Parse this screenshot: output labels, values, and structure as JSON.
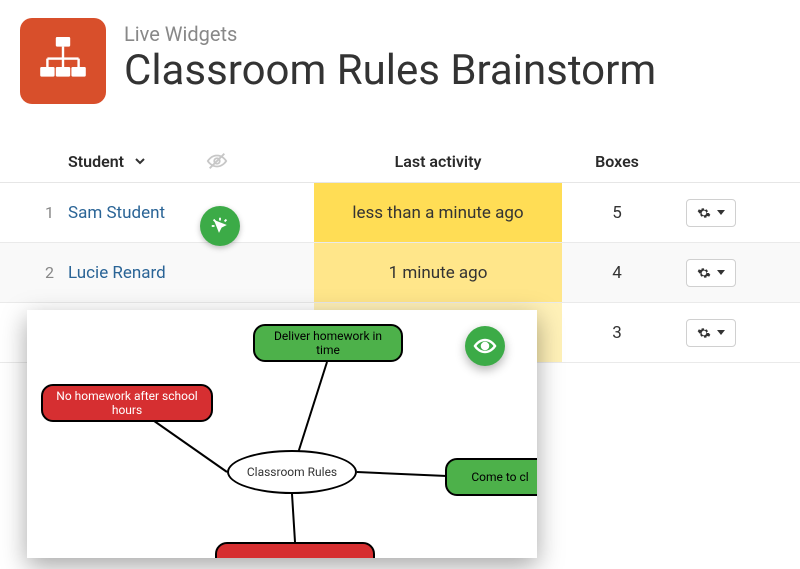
{
  "header": {
    "subtitle": "Live Widgets",
    "title": "Classroom Rules Brainstorm"
  },
  "table": {
    "columns": {
      "student": "Student",
      "activity": "Last activity",
      "boxes": "Boxes"
    },
    "rows": [
      {
        "num": "1",
        "name": "Sam Student",
        "activity": "less than a minute ago",
        "boxes": "5"
      },
      {
        "num": "2",
        "name": "Lucie Renard",
        "activity": "1 minute ago",
        "boxes": "4"
      },
      {
        "num": "",
        "name": "",
        "activity": "",
        "boxes": "3"
      }
    ]
  },
  "mindmap": {
    "center": "Classroom Rules",
    "nodes": {
      "top": "Deliver homework in time",
      "left": "No homework after school hours",
      "right": "Come to cl",
      "bottom": ""
    }
  },
  "icons": {
    "app": "mindmap-icon",
    "hide": "eye-off-icon",
    "gear": "gear-icon",
    "click": "cursor-click-icon",
    "eye": "eye-icon",
    "chevron": "chevron-down-icon"
  }
}
